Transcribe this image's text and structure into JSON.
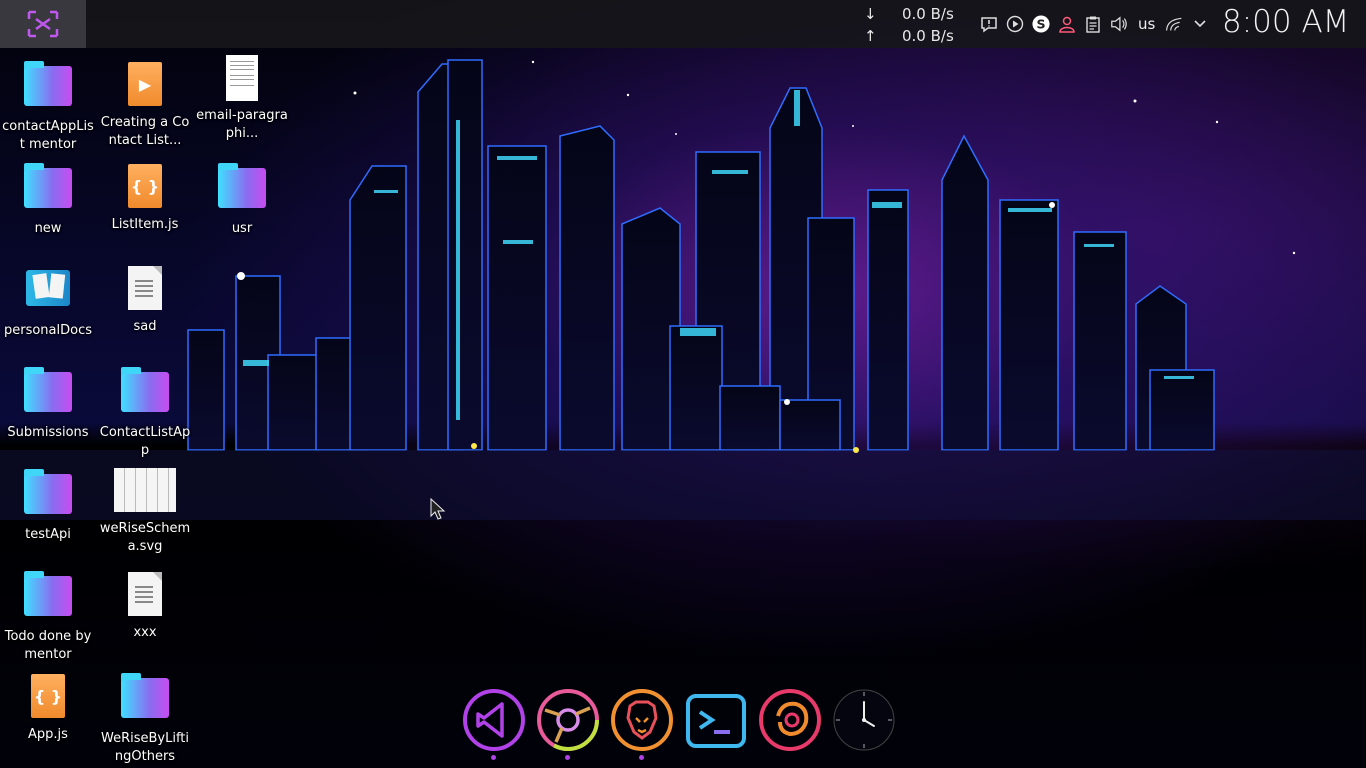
{
  "topbar": {
    "launcher_icon": "app-launcher-icon",
    "net_down_arrow": "↓",
    "net_up_arrow": "↑",
    "net_down": "0.0 B/s",
    "net_up": "0.0 B/s",
    "keyboard_layout": "us",
    "clock": "8:00 AM",
    "tray_icons": [
      "notification-icon",
      "media-player-icon",
      "skype-icon",
      "user-icon",
      "clipboard-icon",
      "volume-icon",
      "wifi-icon",
      "chevron-down-icon"
    ]
  },
  "desktop": {
    "items": [
      {
        "label": "contactAppList mentor",
        "icon": "folder-icon"
      },
      {
        "label": "Creating a Contact List...",
        "icon": "video-file-icon"
      },
      {
        "label": "email-paragraphi...",
        "icon": "document-thumbnail-icon"
      },
      {
        "label": "new",
        "icon": "folder-icon"
      },
      {
        "label": "ListItem.js",
        "icon": "js-file-icon"
      },
      {
        "label": "usr",
        "icon": "folder-icon"
      },
      {
        "label": "personalDocs",
        "icon": "pictures-folder-icon"
      },
      {
        "label": "sad",
        "icon": "text-file-icon"
      },
      {
        "label": "Submissions",
        "icon": "folder-icon"
      },
      {
        "label": "ContactListApp",
        "icon": "folder-icon"
      },
      {
        "label": "testApi",
        "icon": "folder-icon"
      },
      {
        "label": "weRiseSchema.svg",
        "icon": "svg-file-icon"
      },
      {
        "label": "Todo done by mentor",
        "icon": "folder-icon"
      },
      {
        "label": "xxx",
        "icon": "text-file-icon"
      },
      {
        "label": "App.js",
        "icon": "js-file-icon"
      },
      {
        "label": "WeRiseByLiftingOthers",
        "icon": "folder-icon"
      }
    ]
  },
  "dock": {
    "items": [
      {
        "name": "vscode",
        "icon": "vscode-icon",
        "running": true
      },
      {
        "name": "chrome",
        "icon": "chrome-icon",
        "running": true
      },
      {
        "name": "brave",
        "icon": "brave-icon",
        "running": true
      },
      {
        "name": "terminal",
        "icon": "terminal-icon",
        "running": false
      },
      {
        "name": "firefox",
        "icon": "firefox-icon",
        "running": false
      },
      {
        "name": "clock",
        "icon": "analog-clock-icon",
        "running": false
      }
    ]
  },
  "colors": {
    "accent": "#b042e8",
    "panel": "#16161a",
    "neon_cyan": "#3fd6f8"
  }
}
